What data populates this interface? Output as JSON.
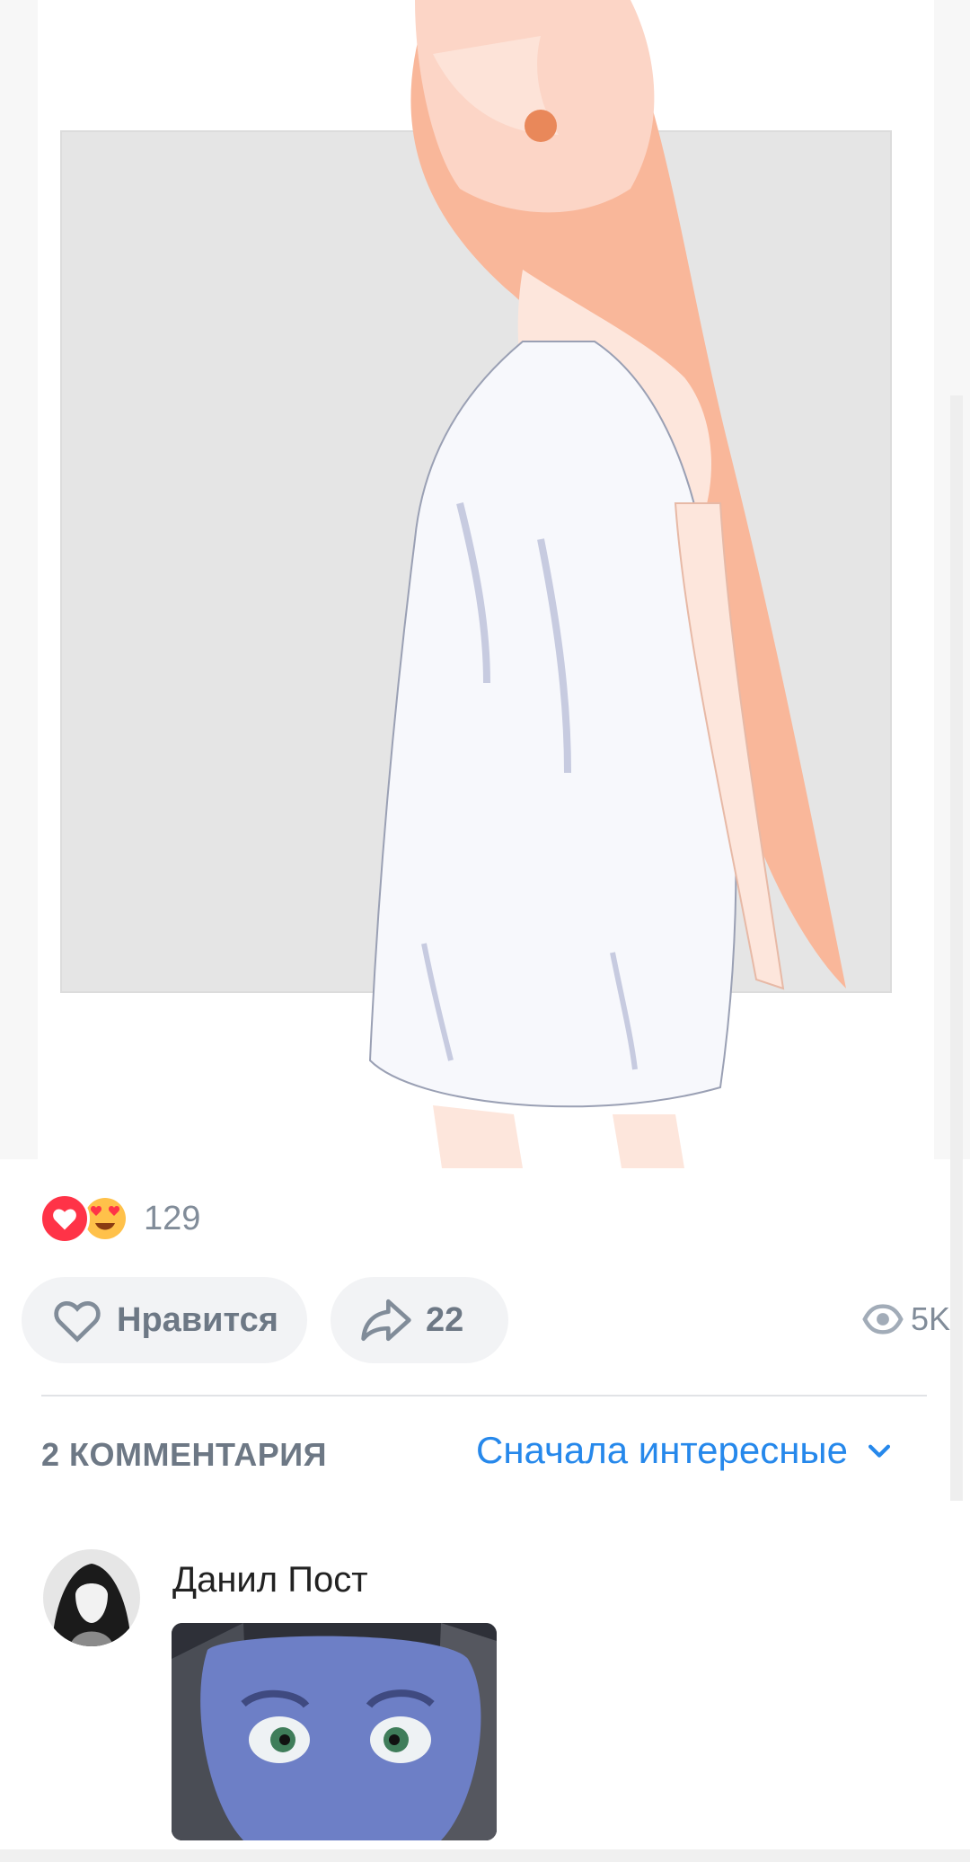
{
  "post": {
    "reactions": {
      "icons": [
        "heart-icon",
        "heart-eyes-icon"
      ],
      "count": "129"
    },
    "actions": {
      "like_label": "Нравится",
      "share_count": "22"
    },
    "views": "5K"
  },
  "comments": {
    "count_label": "2 КОММЕНТАРИЯ",
    "sort_label": "Сначала интересные",
    "items": [
      {
        "author": "Данил Пост"
      }
    ]
  },
  "colors": {
    "accent": "#2688eb",
    "like_red": "#ff3347",
    "secondary_text": "#818c99",
    "button_bg": "#f2f3f5"
  }
}
